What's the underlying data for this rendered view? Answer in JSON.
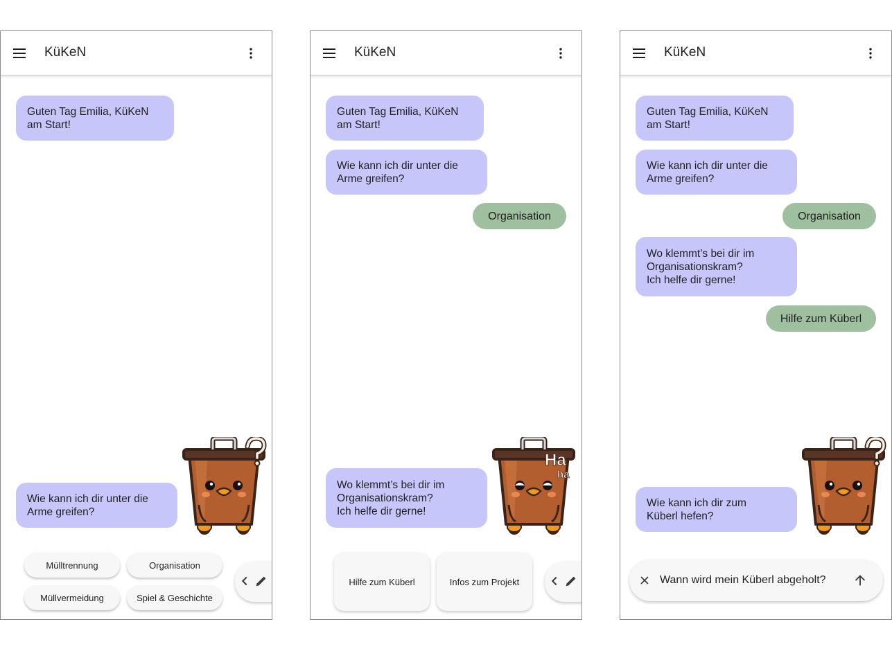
{
  "app": {
    "title": "KüKeN"
  },
  "colors": {
    "bot_bubble": "#c6c6fb",
    "user_bubble": "#9fc09e",
    "chip_bg": "#f7f7f7"
  },
  "icons": {
    "menu": "hamburger-menu-icon",
    "more": "more-vertical-icon",
    "prev": "chevron-left-icon",
    "edit": "pencil-icon",
    "clear": "close-icon",
    "send": "arrow-up-icon",
    "mascot": "trash-bin-mascot"
  },
  "screens": [
    {
      "messages": [
        {
          "from": "bot",
          "text": "Guten Tag Emilia, KüKeN\nam Start!"
        },
        {
          "from": "bot",
          "text": "Wie kann ich dir unter die\nArme greifen?"
        }
      ],
      "chips": [
        "Mülltrennung",
        "Organisation",
        "Müllvermeidung",
        "Spiel & Geschichte"
      ],
      "mascot_expression": "question"
    },
    {
      "messages": [
        {
          "from": "bot",
          "text": "Guten Tag Emilia, KüKeN\nam Start!"
        },
        {
          "from": "bot",
          "text": "Wie kann ich dir unter die\nArme greifen?"
        },
        {
          "from": "user",
          "text": "Organisation"
        },
        {
          "from": "bot",
          "text": "Wo klemmt’s bei dir im\nOrganisationskram?\nIch helfe dir gerne!"
        }
      ],
      "chips": [
        "Hilfe zum Küberl",
        "Infos zum Projekt"
      ],
      "mascot_expression": "laughing",
      "mascot_text": {
        "big": "Ha",
        "small": "ha"
      }
    },
    {
      "messages": [
        {
          "from": "bot",
          "text": "Guten Tag Emilia, KüKeN\nam Start!"
        },
        {
          "from": "bot",
          "text": "Wie kann ich dir unter die\nArme greifen?"
        },
        {
          "from": "user",
          "text": "Organisation"
        },
        {
          "from": "bot",
          "text": "Wo klemmt’s bei dir im\nOrganisationskram?\nIch helfe dir gerne!"
        },
        {
          "from": "user",
          "text": "Hilfe zum Küberl"
        },
        {
          "from": "bot",
          "text": "Wie kann ich dir zum\nKüberl hefen?"
        }
      ],
      "input": {
        "value": "Wann wird mein Küberl abgeholt?"
      },
      "mascot_expression": "question"
    }
  ]
}
